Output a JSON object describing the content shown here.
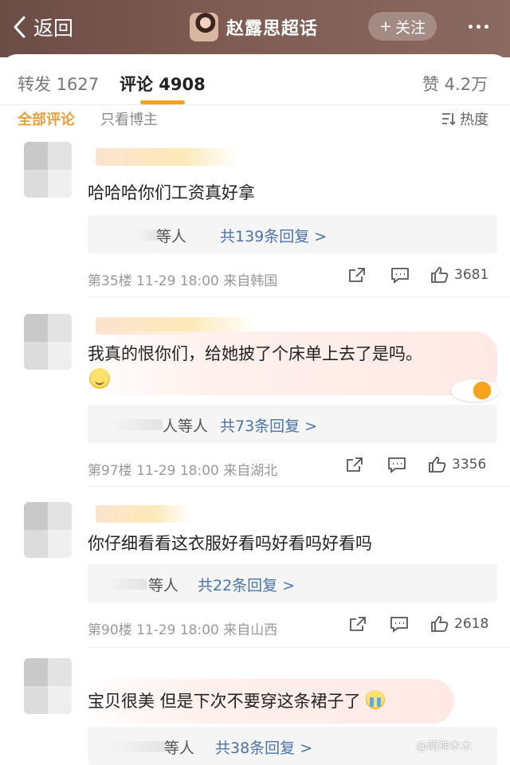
{
  "header": {
    "back_label": "返回",
    "topic_title": "赵露思超话",
    "follow_label": "关注",
    "follow_plus": "+"
  },
  "tabs": {
    "repost": "转发 1627",
    "comments": "评论 4908",
    "likes": "赞 4.2万"
  },
  "filters": {
    "all": "全部评论",
    "blogger_only": "只看博主",
    "sort": "热度"
  },
  "comments": [
    {
      "text": "哈哈哈你们工资真好拿",
      "replies_partial": "等人",
      "replies": "共139条回复 >",
      "meta": "第35楼 11-29 18:00 来自韩国",
      "likes": "3681"
    },
    {
      "text": "我真的恨你们，给她披了个床单上去了是吗。",
      "emoji": "smile-icon",
      "replies_partial": "人等人",
      "replies": "共73条回复 >",
      "meta": "第97楼 11-29 18:00 来自湖北",
      "likes": "3356"
    },
    {
      "text": "你仔细看看这衣服好看吗好看吗好看吗",
      "replies_partial": "等人",
      "replies": "共22条回复 >",
      "meta": "第90楼 11-29 18:00 来自山西",
      "likes": "2618"
    },
    {
      "text": "宝贝很美 但是下次不要穿这条裙子了",
      "emoji": "crying-icon",
      "replies_partial": "等人",
      "replies": "共38条回复 >"
    }
  ],
  "watermark": "@萌神木木",
  "colors": {
    "accent": "#f7a21b",
    "reply_link": "#4a74a8",
    "header_bg": "#7f5b53"
  }
}
